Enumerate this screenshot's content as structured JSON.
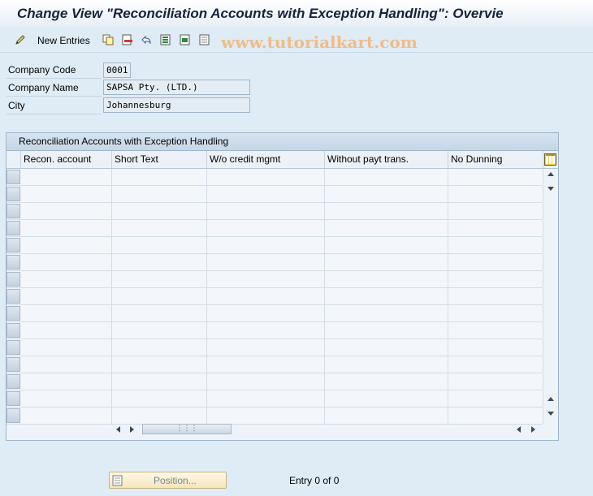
{
  "window": {
    "title": "Change View \"Reconciliation Accounts with Exception Handling\": Overvie"
  },
  "toolbar": {
    "new_entries_label": "New Entries",
    "icons": [
      "edit-pencil-icon",
      "copy-icon",
      "delete-icon",
      "undo-icon",
      "select-all-icon",
      "select-block-icon",
      "deselect-all-icon"
    ]
  },
  "watermark": "www.tutorialkart.com",
  "header_fields": [
    {
      "label": "Company Code",
      "value": "0001"
    },
    {
      "label": "Company Name",
      "value": "SAPSA Pty. (LTD.)"
    },
    {
      "label": "City",
      "value": "Johannesburg"
    }
  ],
  "table": {
    "caption": "Reconciliation Accounts with Exception Handling",
    "columns": [
      "Recon. account",
      "Short Text",
      "W/o credit mgmt",
      "Without payt trans.",
      "No Dunning"
    ],
    "row_count_visible": 15,
    "rows": []
  },
  "footer": {
    "position_button_label": "Position...",
    "entry_info": "Entry 0 of 0"
  },
  "colors": {
    "background": "#dfebf5",
    "title_text": "#15233a",
    "watermark": "#f0b67a",
    "position_button": "#f5e6bb"
  }
}
